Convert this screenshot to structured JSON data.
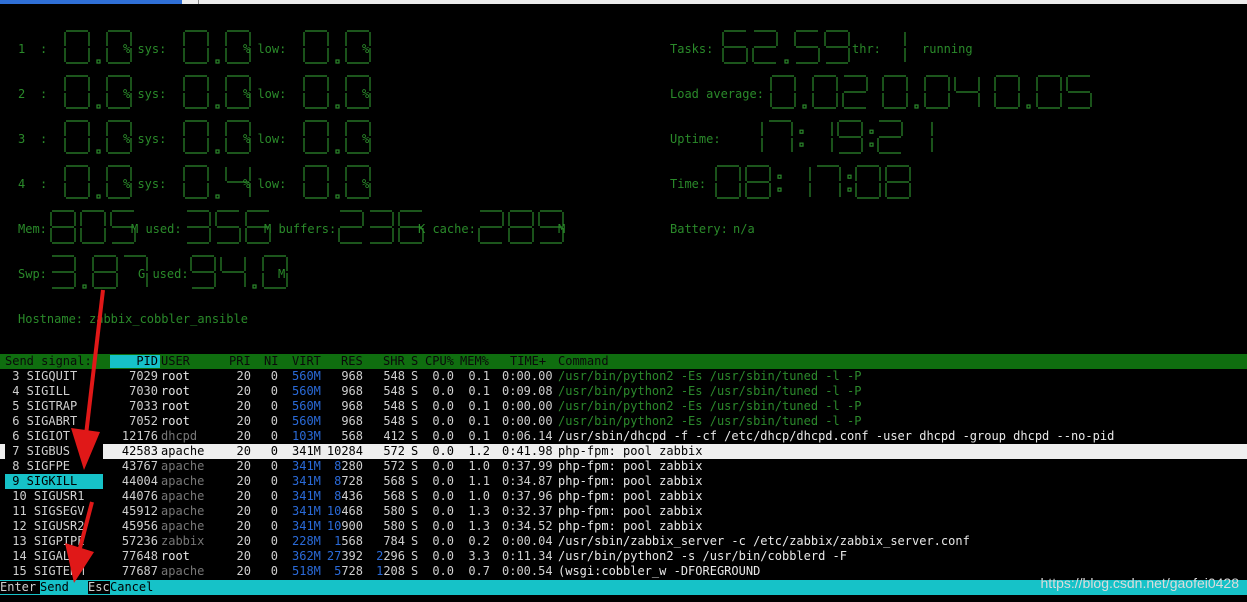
{
  "meters": {
    "cpu_rows": [
      {
        "id": "1",
        "user": "0.0",
        "sys": "0.0",
        "low": "0.0"
      },
      {
        "id": "2",
        "user": "0.0",
        "sys": "0.0",
        "low": "0.0"
      },
      {
        "id": "3",
        "user": "0.0",
        "sys": "0.0",
        "low": "0.0"
      },
      {
        "id": "4",
        "user": "0.0",
        "sys": "0.4",
        "low": "0.0"
      }
    ],
    "cpu_sep": ":",
    "pct": "%",
    "sys_label": "% sys:",
    "low_label": "% low:",
    "mem": {
      "label": "Mem:",
      "total": "805",
      "used_label": "M used:",
      "used": "356",
      "buffers_label": "M buffers:",
      "buffers": "236",
      "cache_label": "K cache:",
      "cache": "289",
      "unit": "M"
    },
    "swp": {
      "label": "Swp:",
      "total": "3.87",
      "used_label": "G used:",
      "used": "94.0",
      "unit": "M"
    },
    "hostname": {
      "label": "Hostname:",
      "value": "zabbix_cobbler_ansible"
    },
    "tasks": {
      "label": "Tasks:",
      "value": "62.59",
      "thr_label": "thr:",
      "thr": "1",
      "running": "running"
    },
    "load": {
      "label": "Load average:",
      "value": "0.02 0.04 0.05"
    },
    "uptime": {
      "label": "Uptime:",
      "value": "17:19:21"
    },
    "time": {
      "label": "Time:",
      "value": "08:17:08"
    },
    "battery": {
      "label": "Battery:",
      "value": "n/a"
    }
  },
  "signals_header": "Send signal:",
  "signals": [
    "3 SIGQUIT",
    "4 SIGILL",
    "5 SIGTRAP",
    "6 SIGABRT",
    "6 SIGIOT",
    "7 SIGBUS",
    "8 SIGFPE",
    "9 SIGKILL",
    "10 SIGUSR1",
    "11 SIGSEGV",
    "12 SIGUSR2",
    "13 SIGPIPE",
    "14 SIGALRM",
    "15 SIGTERM"
  ],
  "selected_signal_index": 7,
  "columns": [
    "PID",
    "USER",
    "PRI",
    "NI",
    "VIRT",
    "RES",
    "SHR",
    "S",
    "CPU%",
    "MEM%",
    "TIME+",
    "Command"
  ],
  "processes": [
    {
      "pid": "7029",
      "user": "root",
      "pri": "20",
      "ni": "0",
      "virt": "560M",
      "res": "968",
      "shr": "548",
      "s": "S",
      "cpu": "0.0",
      "mem": "0.1",
      "time": "0:00.00",
      "cmd": "/usr/bin/python2 -Es /usr/sbin/tuned -l -P",
      "cmd_style": "grn",
      "user_style": "wht"
    },
    {
      "pid": "7030",
      "user": "root",
      "pri": "20",
      "ni": "0",
      "virt": "560M",
      "res": "968",
      "shr": "548",
      "s": "S",
      "cpu": "0.0",
      "mem": "0.1",
      "time": "0:09.08",
      "cmd": "/usr/bin/python2 -Es /usr/sbin/tuned -l -P",
      "cmd_style": "grn",
      "user_style": "wht"
    },
    {
      "pid": "7033",
      "user": "root",
      "pri": "20",
      "ni": "0",
      "virt": "560M",
      "res": "968",
      "shr": "548",
      "s": "S",
      "cpu": "0.0",
      "mem": "0.1",
      "time": "0:00.00",
      "cmd": "/usr/bin/python2 -Es /usr/sbin/tuned -l -P",
      "cmd_style": "grn",
      "user_style": "wht"
    },
    {
      "pid": "7052",
      "user": "root",
      "pri": "20",
      "ni": "0",
      "virt": "560M",
      "res": "968",
      "shr": "548",
      "s": "S",
      "cpu": "0.0",
      "mem": "0.1",
      "time": "0:00.00",
      "cmd": "/usr/bin/python2 -Es /usr/sbin/tuned -l -P",
      "cmd_style": "grn",
      "user_style": "wht"
    },
    {
      "pid": "12176",
      "user": "dhcpd",
      "pri": "20",
      "ni": "0",
      "virt": "103M",
      "res": "568",
      "shr": "412",
      "s": "S",
      "cpu": "0.0",
      "mem": "0.1",
      "time": "0:06.14",
      "cmd": "/usr/sbin/dhcpd -f -cf /etc/dhcp/dhcpd.conf -user dhcpd -group dhcpd --no-pid",
      "cmd_style": "wht",
      "user_style": "dim"
    },
    {
      "pid": "42583",
      "user": "apache",
      "pri": "20",
      "ni": "0",
      "virt": "341M",
      "res": "10284",
      "shr": "572",
      "s": "S",
      "cpu": "0.0",
      "mem": "1.2",
      "time": "0:41.98",
      "cmd": "php-fpm: pool zabbix",
      "cmd_style": "wht",
      "user_style": "dim"
    },
    {
      "pid": "43767",
      "user": "apache",
      "pri": "20",
      "ni": "0",
      "virt": "341M",
      "res": "8280",
      "shr": "572",
      "s": "S",
      "cpu": "0.0",
      "mem": "1.0",
      "time": "0:37.99",
      "cmd": "php-fpm: pool zabbix",
      "cmd_style": "wht",
      "user_style": "dim"
    },
    {
      "pid": "44004",
      "user": "apache",
      "pri": "20",
      "ni": "0",
      "virt": "341M",
      "res": "8728",
      "shr": "568",
      "s": "S",
      "cpu": "0.0",
      "mem": "1.1",
      "time": "0:34.87",
      "cmd": "php-fpm: pool zabbix",
      "cmd_style": "wht",
      "user_style": "dim"
    },
    {
      "pid": "44076",
      "user": "apache",
      "pri": "20",
      "ni": "0",
      "virt": "341M",
      "res": "8436",
      "shr": "568",
      "s": "S",
      "cpu": "0.0",
      "mem": "1.0",
      "time": "0:37.96",
      "cmd": "php-fpm: pool zabbix",
      "cmd_style": "wht",
      "user_style": "dim"
    },
    {
      "pid": "45912",
      "user": "apache",
      "pri": "20",
      "ni": "0",
      "virt": "341M",
      "res": "10468",
      "shr": "580",
      "s": "S",
      "cpu": "0.0",
      "mem": "1.3",
      "time": "0:32.37",
      "cmd": "php-fpm: pool zabbix",
      "cmd_style": "wht",
      "user_style": "dim"
    },
    {
      "pid": "45956",
      "user": "apache",
      "pri": "20",
      "ni": "0",
      "virt": "341M",
      "res": "10900",
      "shr": "580",
      "s": "S",
      "cpu": "0.0",
      "mem": "1.3",
      "time": "0:34.52",
      "cmd": "php-fpm: pool zabbix",
      "cmd_style": "wht",
      "user_style": "dim"
    },
    {
      "pid": "57236",
      "user": "zabbix",
      "pri": "20",
      "ni": "0",
      "virt": "228M",
      "res": "1568",
      "shr": "784",
      "s": "S",
      "cpu": "0.0",
      "mem": "0.2",
      "time": "0:00.04",
      "cmd": "/usr/sbin/zabbix_server -c /etc/zabbix/zabbix_server.conf",
      "cmd_style": "wht",
      "user_style": "dim"
    },
    {
      "pid": "77648",
      "user": "root",
      "pri": "20",
      "ni": "0",
      "virt": "362M",
      "res": "27392",
      "shr": "2296",
      "s": "S",
      "cpu": "0.0",
      "mem": "3.3",
      "time": "0:11.34",
      "cmd": "/usr/bin/python2 -s /usr/bin/cobblerd -F",
      "cmd_style": "wht",
      "user_style": "wht"
    },
    {
      "pid": "77687",
      "user": "apache",
      "pri": "20",
      "ni": "0",
      "virt": "518M",
      "res": "5728",
      "shr": "1208",
      "s": "S",
      "cpu": "0.0",
      "mem": "0.7",
      "time": "0:00.54",
      "cmd": "(wsgi:cobbler_w -DFOREGROUND",
      "cmd_style": "wht",
      "user_style": "dim"
    }
  ],
  "selected_process_index": 5,
  "footer": {
    "enter_key": "Enter",
    "send": "Send",
    "esc_key": "Esc",
    "cancel": "Cancel"
  },
  "watermark": "https://blog.csdn.net/gaofei0428",
  "colors": {
    "accent_cyan": "#16c2c8",
    "header_green": "#0f6e0f",
    "meter_green": "#2c8a2c",
    "arrow_red": "#e01818"
  }
}
